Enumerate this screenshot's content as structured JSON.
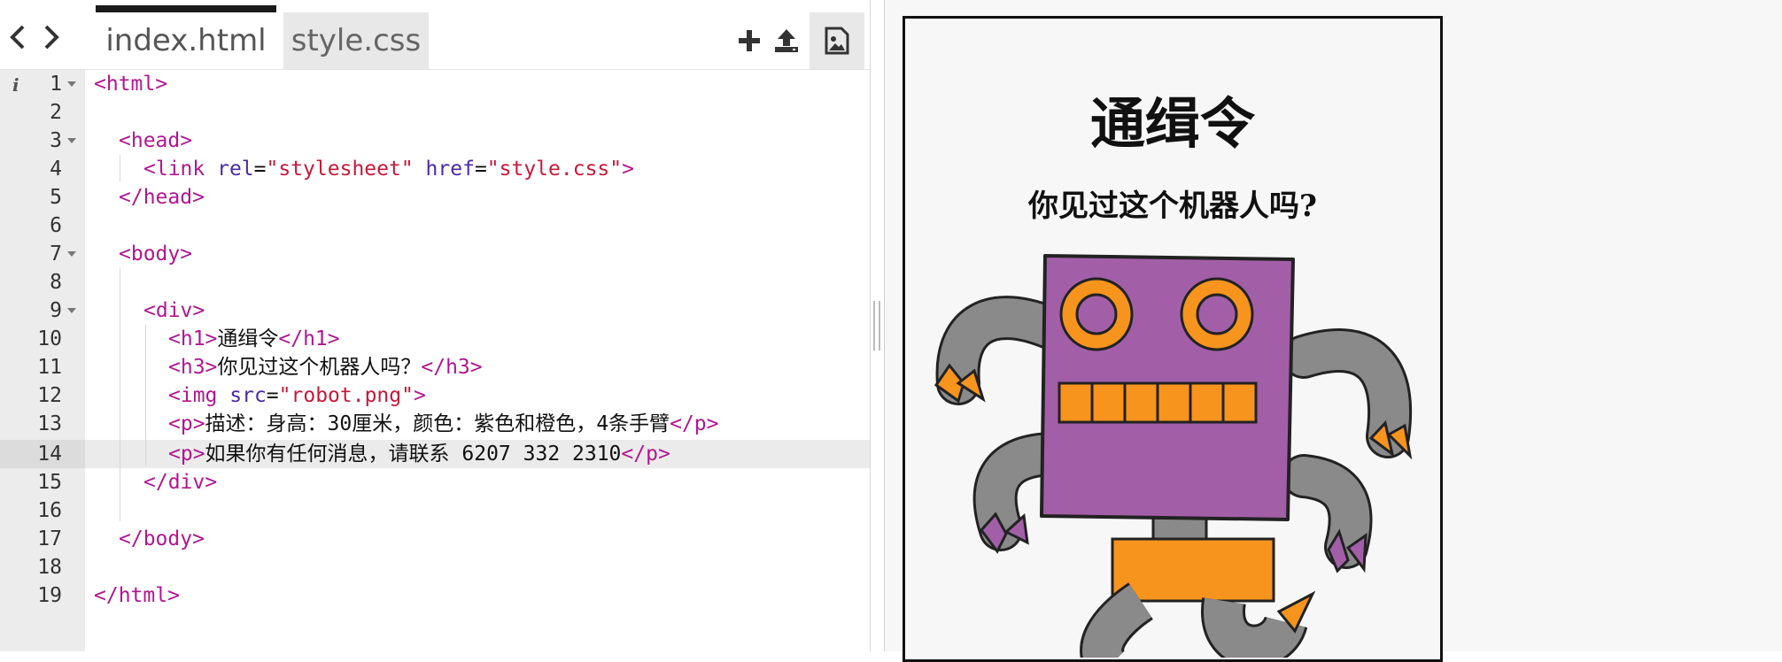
{
  "editor": {
    "tabs": [
      {
        "label": "index.html",
        "active": true
      },
      {
        "label": "style.css",
        "active": false
      }
    ],
    "tools": [
      "add-icon",
      "upload-icon",
      "image-icon"
    ],
    "line_numbers": [
      "1",
      "2",
      "3",
      "4",
      "5",
      "6",
      "7",
      "8",
      "9",
      "10",
      "11",
      "12",
      "13",
      "14",
      "15",
      "16",
      "17",
      "18",
      "19"
    ],
    "active_line": "14",
    "lines": {
      "l1": {
        "open": "<html>"
      },
      "l3": {
        "open": "<head>"
      },
      "l4": {
        "tag": "<link",
        "attr1": "rel",
        "eq1": "=",
        "val1": "\"stylesheet\"",
        "attr2": "href",
        "eq2": "=",
        "val2": "\"style.css\"",
        "close": ">"
      },
      "l5": {
        "close": "</head>"
      },
      "l7": {
        "open": "<body>"
      },
      "l9": {
        "open": "<div>"
      },
      "l10": {
        "open": "<h1>",
        "text": "通缉令",
        "close": "</h1>"
      },
      "l11": {
        "open": "<h3>",
        "text": "你见过这个机器人吗？",
        "close": "</h3>"
      },
      "l12": {
        "tag": "<img",
        "attr": "src",
        "eq": "=",
        "val": "\"robot.png\"",
        "close": ">"
      },
      "l13": {
        "open": "<p>",
        "text": "描述：身高：30厘米，颜色：紫色和橙色，4条手臂",
        "close": "</p>"
      },
      "l14": {
        "open": "<p>",
        "text": "如果你有任何消息，请联系 6207 332 2310",
        "close": "</p>"
      },
      "l15": {
        "close": "</div>"
      },
      "l17": {
        "close": "</body>"
      },
      "l19": {
        "close": "</html>"
      }
    }
  },
  "preview": {
    "h1": "通缉令",
    "h3": "你见过这个机器人吗?",
    "image": "robot-illustration"
  },
  "colors": {
    "tag": "#b0178f",
    "attribute": "#4a2aa8",
    "string": "#c7193a",
    "robot_body": "#a25fa8",
    "robot_orange": "#f7941d",
    "robot_gray": "#8a8a8a"
  }
}
